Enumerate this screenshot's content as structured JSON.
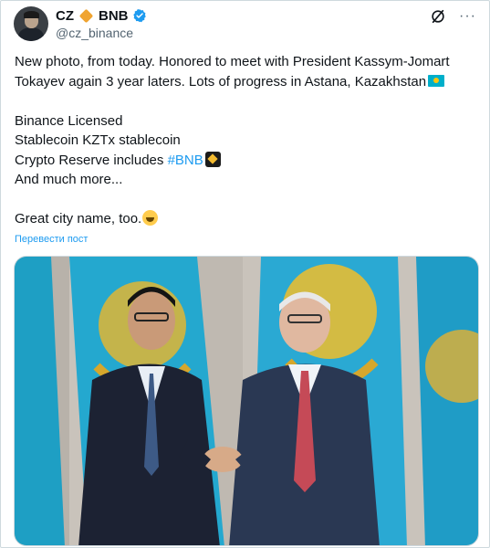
{
  "author": {
    "name": "CZ",
    "name_suffix": "BNB",
    "handle": "@cz_binance",
    "avatar_icon": "profile-avatar",
    "badge_icon": "verified-badge-icon"
  },
  "top_actions": {
    "grok_icon": "grok-icon",
    "more_label": "···"
  },
  "tweet": {
    "line1": "New photo, from today. Honored to meet with President Kassym-Jomart Tokayev again 3 year laters. Lots of progress in Astana, Kazakhstan",
    "line2": "Binance Licensed",
    "line3": "Stablecoin KZTx stablecoin",
    "line4_prefix": "Crypto Reserve includes ",
    "line4_hashtag": "#BNB",
    "line5": "And much more...",
    "line6": "Great city name, too."
  },
  "translate_label": "Перевести пост",
  "colors": {
    "link": "#1d9bf0",
    "text": "#0f1419",
    "muted": "#536471",
    "flag_blue": "#00afca",
    "flag_gold": "#fec50c"
  }
}
